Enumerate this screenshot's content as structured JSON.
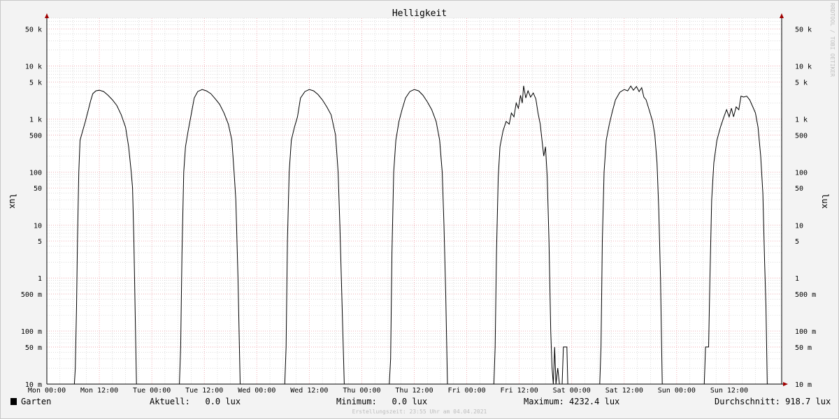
{
  "chart_data": {
    "type": "line",
    "title": "Helligkeit",
    "ylabel": "lux",
    "y_scale": "log",
    "ylim": [
      0.01,
      80000
    ],
    "y_ticks": [
      {
        "value": 50000,
        "label": "50 k"
      },
      {
        "value": 10000,
        "label": "10 k"
      },
      {
        "value": 5000,
        "label": "5 k"
      },
      {
        "value": 1000,
        "label": "1 k"
      },
      {
        "value": 500,
        "label": "500"
      },
      {
        "value": 100,
        "label": "100"
      },
      {
        "value": 50,
        "label": "50"
      },
      {
        "value": 10,
        "label": "10"
      },
      {
        "value": 5,
        "label": "5"
      },
      {
        "value": 1,
        "label": "1"
      },
      {
        "value": 0.5,
        "label": "500 m"
      },
      {
        "value": 0.1,
        "label": "100 m"
      },
      {
        "value": 0.05,
        "label": "50 m"
      },
      {
        "value": 0.01,
        "label": "10 m"
      }
    ],
    "x_unit": "hours since Mon 00:00",
    "xlim": [
      0,
      168
    ],
    "x_ticks": [
      {
        "value": 0,
        "label": "Mon 00:00"
      },
      {
        "value": 12,
        "label": "Mon 12:00"
      },
      {
        "value": 24,
        "label": "Tue 00:00"
      },
      {
        "value": 36,
        "label": "Tue 12:00"
      },
      {
        "value": 48,
        "label": "Wed 00:00"
      },
      {
        "value": 60,
        "label": "Wed 12:00"
      },
      {
        "value": 72,
        "label": "Thu 00:00"
      },
      {
        "value": 84,
        "label": "Thu 12:00"
      },
      {
        "value": 96,
        "label": "Fri 00:00"
      },
      {
        "value": 108,
        "label": "Fri 12:00"
      },
      {
        "value": 120,
        "label": "Sat 00:00"
      },
      {
        "value": 132,
        "label": "Sat 12:00"
      },
      {
        "value": 144,
        "label": "Sun 00:00"
      },
      {
        "value": 156,
        "label": "Sun 12:00"
      }
    ],
    "grid": true,
    "series": [
      {
        "name": "Garten",
        "color": "#000000",
        "points": [
          [
            0,
            0.01
          ],
          [
            6.3,
            0.01
          ],
          [
            6.5,
            0.02
          ],
          [
            6.8,
            0.3
          ],
          [
            7.0,
            5
          ],
          [
            7.3,
            100
          ],
          [
            7.6,
            400
          ],
          [
            8.2,
            600
          ],
          [
            8.8,
            900
          ],
          [
            9.5,
            1500
          ],
          [
            10.0,
            2200
          ],
          [
            10.5,
            3000
          ],
          [
            11.2,
            3400
          ],
          [
            12.0,
            3500
          ],
          [
            13.0,
            3300
          ],
          [
            14.0,
            2800
          ],
          [
            15.0,
            2300
          ],
          [
            16.0,
            1800
          ],
          [
            17.0,
            1200
          ],
          [
            18.0,
            700
          ],
          [
            18.7,
            300
          ],
          [
            19.3,
            100
          ],
          [
            19.6,
            50
          ],
          [
            19.9,
            5
          ],
          [
            20.2,
            0.2
          ],
          [
            20.5,
            0.01
          ],
          [
            24,
            0.01
          ],
          [
            30.3,
            0.01
          ],
          [
            30.6,
            0.05
          ],
          [
            30.9,
            3
          ],
          [
            31.3,
            100
          ],
          [
            31.7,
            300
          ],
          [
            32.3,
            600
          ],
          [
            33.0,
            1200
          ],
          [
            33.7,
            2500
          ],
          [
            34.5,
            3300
          ],
          [
            35.5,
            3600
          ],
          [
            36.5,
            3400
          ],
          [
            37.5,
            3000
          ],
          [
            38.5,
            2400
          ],
          [
            39.5,
            1900
          ],
          [
            40.5,
            1300
          ],
          [
            41.5,
            800
          ],
          [
            42.3,
            400
          ],
          [
            42.8,
            100
          ],
          [
            43.2,
            30
          ],
          [
            43.7,
            1
          ],
          [
            44.2,
            0.01
          ],
          [
            48,
            0.01
          ],
          [
            54.4,
            0.01
          ],
          [
            54.7,
            0.05
          ],
          [
            55.0,
            5
          ],
          [
            55.4,
            100
          ],
          [
            55.9,
            400
          ],
          [
            56.6,
            700
          ],
          [
            57.3,
            1100
          ],
          [
            58.0,
            2500
          ],
          [
            59.0,
            3300
          ],
          [
            60.0,
            3600
          ],
          [
            61.0,
            3400
          ],
          [
            62.0,
            2900
          ],
          [
            63.0,
            2300
          ],
          [
            64.0,
            1700
          ],
          [
            65.0,
            1200
          ],
          [
            66.0,
            500
          ],
          [
            66.6,
            100
          ],
          [
            67.0,
            10
          ],
          [
            67.5,
            0.3
          ],
          [
            68.0,
            0.01
          ],
          [
            72,
            0.01
          ],
          [
            78.3,
            0.01
          ],
          [
            78.6,
            0.03
          ],
          [
            78.9,
            3
          ],
          [
            79.3,
            100
          ],
          [
            79.8,
            400
          ],
          [
            80.5,
            900
          ],
          [
            81.2,
            1500
          ],
          [
            82.0,
            2500
          ],
          [
            83.0,
            3300
          ],
          [
            84.0,
            3600
          ],
          [
            85.0,
            3400
          ],
          [
            86.0,
            2800
          ],
          [
            87.0,
            2100
          ],
          [
            88.0,
            1500
          ],
          [
            89.0,
            900
          ],
          [
            89.8,
            400
          ],
          [
            90.4,
            100
          ],
          [
            90.8,
            10
          ],
          [
            91.2,
            0.5
          ],
          [
            91.6,
            0.01
          ],
          [
            96,
            0.01
          ],
          [
            102.2,
            0.01
          ],
          [
            102.5,
            0.05
          ],
          [
            102.8,
            3
          ],
          [
            103.2,
            80
          ],
          [
            103.6,
            300
          ],
          [
            104.3,
            600
          ],
          [
            105.0,
            900
          ],
          [
            105.7,
            800
          ],
          [
            106.2,
            1300
          ],
          [
            106.8,
            1100
          ],
          [
            107.3,
            2000
          ],
          [
            107.8,
            1600
          ],
          [
            108.3,
            2800
          ],
          [
            108.7,
            2000
          ],
          [
            109.0,
            4232.4
          ],
          [
            109.5,
            2500
          ],
          [
            110.0,
            3400
          ],
          [
            110.6,
            2600
          ],
          [
            111.2,
            3100
          ],
          [
            111.8,
            2400
          ],
          [
            112.3,
            1300
          ],
          [
            112.8,
            800
          ],
          [
            113.2,
            400
          ],
          [
            113.6,
            200
          ],
          [
            114.0,
            300
          ],
          [
            114.4,
            80
          ],
          [
            114.8,
            5
          ],
          [
            115.2,
            0.1
          ],
          [
            115.5,
            0.02
          ],
          [
            115.8,
            0.01
          ],
          [
            116.1,
            0.05
          ],
          [
            116.4,
            0.01
          ],
          [
            116.8,
            0.02
          ],
          [
            117.2,
            0.01
          ],
          [
            117.8,
            0.01
          ],
          [
            118.1,
            0.05
          ],
          [
            118.9,
            0.05
          ],
          [
            119.1,
            0.01
          ],
          [
            120,
            0.01
          ],
          [
            126.4,
            0.01
          ],
          [
            126.7,
            0.05
          ],
          [
            127.0,
            5
          ],
          [
            127.4,
            100
          ],
          [
            127.9,
            400
          ],
          [
            128.6,
            800
          ],
          [
            129.3,
            1400
          ],
          [
            130.0,
            2300
          ],
          [
            131.0,
            3200
          ],
          [
            132.0,
            3600
          ],
          [
            132.8,
            3400
          ],
          [
            133.5,
            4200
          ],
          [
            134.1,
            3500
          ],
          [
            134.8,
            4100
          ],
          [
            135.4,
            3300
          ],
          [
            136.0,
            3900
          ],
          [
            136.5,
            2600
          ],
          [
            137.0,
            2300
          ],
          [
            137.8,
            1400
          ],
          [
            138.5,
            900
          ],
          [
            139.0,
            500
          ],
          [
            139.5,
            150
          ],
          [
            139.9,
            20
          ],
          [
            140.3,
            1
          ],
          [
            140.7,
            0.01
          ],
          [
            144,
            0.01
          ],
          [
            150.3,
            0.01
          ],
          [
            150.6,
            0.05
          ],
          [
            151.3,
            0.05
          ],
          [
            151.6,
            1
          ],
          [
            152.0,
            30
          ],
          [
            152.5,
            150
          ],
          [
            153.2,
            400
          ],
          [
            154.0,
            700
          ],
          [
            154.8,
            1100
          ],
          [
            155.4,
            1500
          ],
          [
            156.0,
            1100
          ],
          [
            156.5,
            1600
          ],
          [
            157.0,
            1100
          ],
          [
            157.6,
            1700
          ],
          [
            158.2,
            1500
          ],
          [
            158.7,
            2700
          ],
          [
            159.3,
            2600
          ],
          [
            160.0,
            2700
          ],
          [
            160.7,
            2300
          ],
          [
            161.4,
            1700
          ],
          [
            162.0,
            1300
          ],
          [
            162.6,
            700
          ],
          [
            163.2,
            200
          ],
          [
            163.7,
            40
          ],
          [
            164.1,
            2
          ],
          [
            164.4,
            0.3
          ],
          [
            164.7,
            0.01
          ],
          [
            168,
            0.01
          ]
        ]
      }
    ]
  },
  "legend": {
    "series_name": "Garten",
    "swatch_color": "#000000",
    "current": "Aktuell:   0.0 lux",
    "minimum": "Minimum:   0.0 lux",
    "maximum": "Maximum: 4232.4 lux",
    "average": "Durchschnitt: 918.7 lux"
  },
  "footer": "Erstellungszeit: 23:55 Uhr am 04.04.2021",
  "watermark": "RRDTOOL / TOBI OETIKER",
  "colors": {
    "major_grid": "#f0a0a8",
    "minor_grid": "#c8c8c8",
    "arrow": "#a00000",
    "plot_bg": "#ffffff"
  }
}
